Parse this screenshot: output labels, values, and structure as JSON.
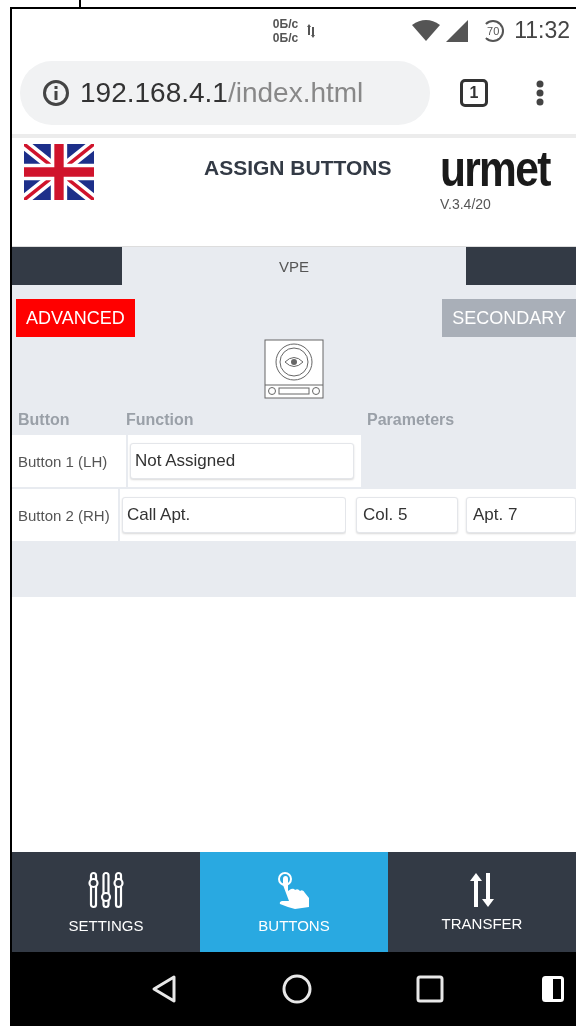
{
  "status_bar": {
    "speed_up": "0Б/с",
    "speed_down": "0Б/с",
    "data_saver": "70",
    "time": "11:32"
  },
  "browser": {
    "url_host": "192.168.4.1",
    "url_path": "/index.html",
    "tab_count": "1"
  },
  "header": {
    "title": "ASSIGN BUTTONS",
    "logo": "urmet",
    "version": "V.3.4/20"
  },
  "tabs": [
    {
      "selected": false
    },
    {
      "label": "VPE",
      "selected": true
    },
    {
      "selected": false
    }
  ],
  "modes": [
    {
      "label": "ADVANCED",
      "selected": true
    },
    {
      "label": "SECONDARY",
      "selected": false
    }
  ],
  "table": {
    "columns": [
      "Button",
      "Function",
      "Parameters"
    ],
    "rows": [
      {
        "button": "Button 1 (LH)",
        "function": "Not Assigned",
        "parameters": []
      },
      {
        "button": "Button 2 (RH)",
        "function": "Call Apt.",
        "parameters": [
          "Col. 5",
          "Apt. 7"
        ]
      }
    ]
  },
  "bottom_nav": [
    {
      "label": "SETTINGS",
      "kind": "settings",
      "selected": false
    },
    {
      "label": "BUTTONS",
      "kind": "buttons",
      "selected": true
    },
    {
      "label": "TRANSFER",
      "kind": "transfer",
      "selected": false
    }
  ]
}
